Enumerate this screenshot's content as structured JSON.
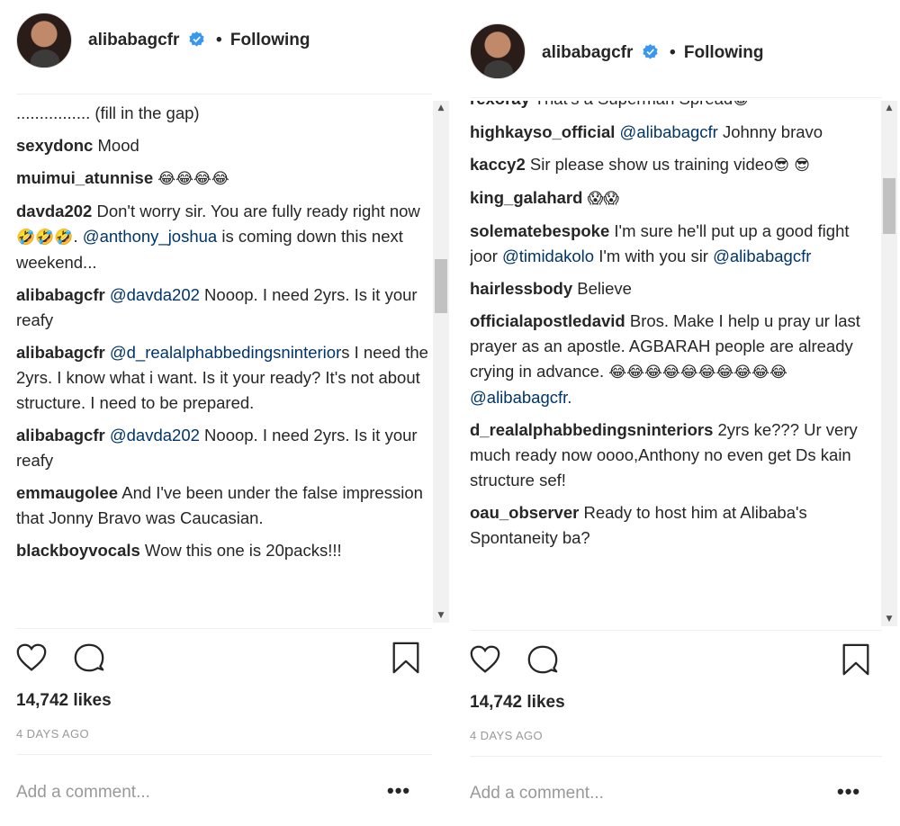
{
  "left": {
    "username": "alibabagcfr",
    "separator": "•",
    "follow_status": "Following",
    "comments": [
      {
        "user": "",
        "parts": [
          {
            "t": "................ (fill in the gap)"
          }
        ]
      },
      {
        "user": "sexydonc",
        "parts": [
          {
            "t": " Mood"
          }
        ]
      },
      {
        "user": "muimui_atunnise",
        "parts": [
          {
            "t": " "
          },
          {
            "e": "😂😂😂😂"
          }
        ]
      },
      {
        "user": "davda202",
        "parts": [
          {
            "t": " Don't worry sir. You are fully ready right now "
          },
          {
            "e": "🤣🤣🤣"
          },
          {
            "t": ". "
          },
          {
            "m": "@anthony_joshua"
          },
          {
            "t": " is coming down this next weekend..."
          }
        ]
      },
      {
        "user": "alibabagcfr",
        "parts": [
          {
            "t": " "
          },
          {
            "m": "@davda202"
          },
          {
            "t": " Nooop. I need 2yrs. Is it your reafy"
          }
        ]
      },
      {
        "user": "alibabagcfr",
        "parts": [
          {
            "t": " "
          },
          {
            "m": "@d_realalphabbedingsninterior"
          },
          {
            "t": "s I need the 2yrs. I know what i want. Is it your ready? It's not about structure. I need to be prepared."
          }
        ]
      },
      {
        "user": "alibabagcfr",
        "parts": [
          {
            "t": " "
          },
          {
            "m": "@davda202"
          },
          {
            "t": " Nooop. I need 2yrs. Is it your reafy"
          }
        ]
      },
      {
        "user": "emmaugolee",
        "parts": [
          {
            "t": " And I've been under the false impression that Jonny Bravo was Caucasian."
          }
        ]
      },
      {
        "user": "blackboyvocals",
        "parts": [
          {
            "t": " Wow this one is 20packs!!!"
          }
        ]
      }
    ],
    "likes": "14,742 likes",
    "timestamp": "4 DAYS AGO",
    "add_comment_placeholder": "Add a comment...",
    "more": "•••",
    "scroll_fraction": 0.33
  },
  "right": {
    "username": "alibabagcfr",
    "separator": "•",
    "follow_status": "Following",
    "comments": [
      {
        "user": "rexoray",
        "parts": [
          {
            "t": " That's a Superman Spread"
          },
          {
            "e": "😁"
          }
        ]
      },
      {
        "user": "highkayso_official",
        "parts": [
          {
            "t": " "
          },
          {
            "m": "@alibabagcfr"
          },
          {
            "t": " Johnny bravo"
          }
        ]
      },
      {
        "user": "kaccy2",
        "parts": [
          {
            "t": " Sir please show us training video"
          },
          {
            "e": "😎"
          },
          {
            "t": " "
          },
          {
            "e": "😎"
          }
        ]
      },
      {
        "user": "king_galahard",
        "parts": [
          {
            "t": " "
          },
          {
            "e": "😱😱"
          }
        ]
      },
      {
        "user": "solematebespoke",
        "parts": [
          {
            "t": " I'm sure he'll put up a good fight joor "
          },
          {
            "m": "@timidakolo"
          },
          {
            "t": " I'm with you sir "
          },
          {
            "m": "@alibabagcfr"
          }
        ]
      },
      {
        "user": "hairlessbody",
        "parts": [
          {
            "t": " Believe"
          }
        ]
      },
      {
        "user": "officialapostledavid",
        "parts": [
          {
            "t": " Bros. Make I help u pray ur last prayer as an apostle. AGBARAH people are already crying in advance. "
          },
          {
            "e": "😂😂😂😂😂😂😂😂😂😂"
          },
          {
            "t": " "
          },
          {
            "m": "@alibabagcfr."
          }
        ]
      },
      {
        "user": "d_realalphabbedingsninteriors",
        "parts": [
          {
            "t": " 2yrs ke??? Ur very much ready now oooo,Anthony no even get Ds kain structure sef!"
          }
        ]
      },
      {
        "user": "oau_observer",
        "parts": [
          {
            "t": " Ready to host him at Alibaba's Spontaneity ba?"
          }
        ]
      }
    ],
    "likes": "14,742 likes",
    "timestamp": "4 DAYS AGO",
    "add_comment_placeholder": "Add a comment...",
    "more": "•••",
    "scroll_fraction": 0.18
  },
  "colors": {
    "mention": "#003569",
    "verified": "#3897f0",
    "muted": "#999999",
    "text": "#262626"
  },
  "icons": [
    "verified-badge-icon",
    "heart-icon",
    "comment-icon",
    "bookmark-icon",
    "more-options-icon"
  ]
}
